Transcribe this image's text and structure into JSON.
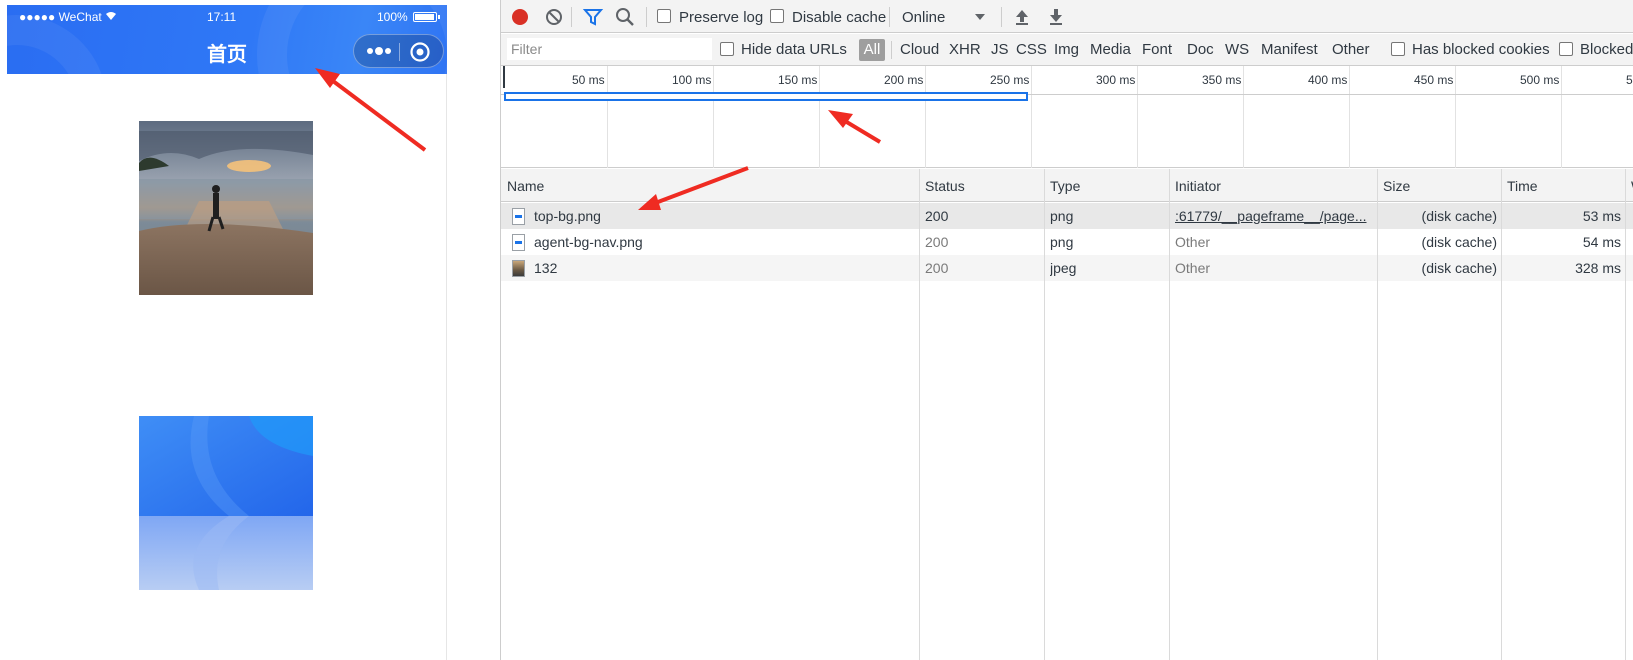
{
  "phone": {
    "status": {
      "carrier": "●●●●● WeChat",
      "time": "17:11",
      "battery": "100%"
    },
    "title": "首页"
  },
  "devtools": {
    "toolbar": {
      "preserve_log": "Preserve log",
      "disable_cache": "Disable cache",
      "throttling": "Online"
    },
    "filterbar": {
      "filter_placeholder": "Filter",
      "hide_data_urls": "Hide data URLs",
      "types": [
        "All",
        "Cloud",
        "XHR",
        "JS",
        "CSS",
        "Img",
        "Media",
        "Font",
        "Doc",
        "WS",
        "Manifest",
        "Other"
      ],
      "has_blocked_cookies": "Has blocked cookies",
      "blocked": "Blocked"
    },
    "timeline_ticks": [
      "50 ms",
      "100 ms",
      "150 ms",
      "200 ms",
      "250 ms",
      "300 ms",
      "350 ms",
      "400 ms",
      "450 ms",
      "500 ms",
      "5"
    ],
    "table": {
      "columns": [
        "Name",
        "Status",
        "Type",
        "Initiator",
        "Size",
        "Time",
        "W"
      ],
      "rows": [
        {
          "name": "top-bg.png",
          "status": "200",
          "type": "png",
          "initiator": ":61779/__pageframe__/page...",
          "size": "(disk cache)",
          "time": "53 ms"
        },
        {
          "name": "agent-bg-nav.png",
          "status": "200",
          "type": "png",
          "initiator": "Other",
          "size": "(disk cache)",
          "time": "54 ms"
        },
        {
          "name": "132",
          "status": "200",
          "type": "jpeg",
          "initiator": "Other",
          "size": "(disk cache)",
          "time": "328 ms"
        }
      ]
    }
  },
  "colors": {
    "accent": "#1a73e8",
    "record": "#d93025",
    "nav_blue": "#2f78f6",
    "arrow_red": "#ef2b22"
  }
}
